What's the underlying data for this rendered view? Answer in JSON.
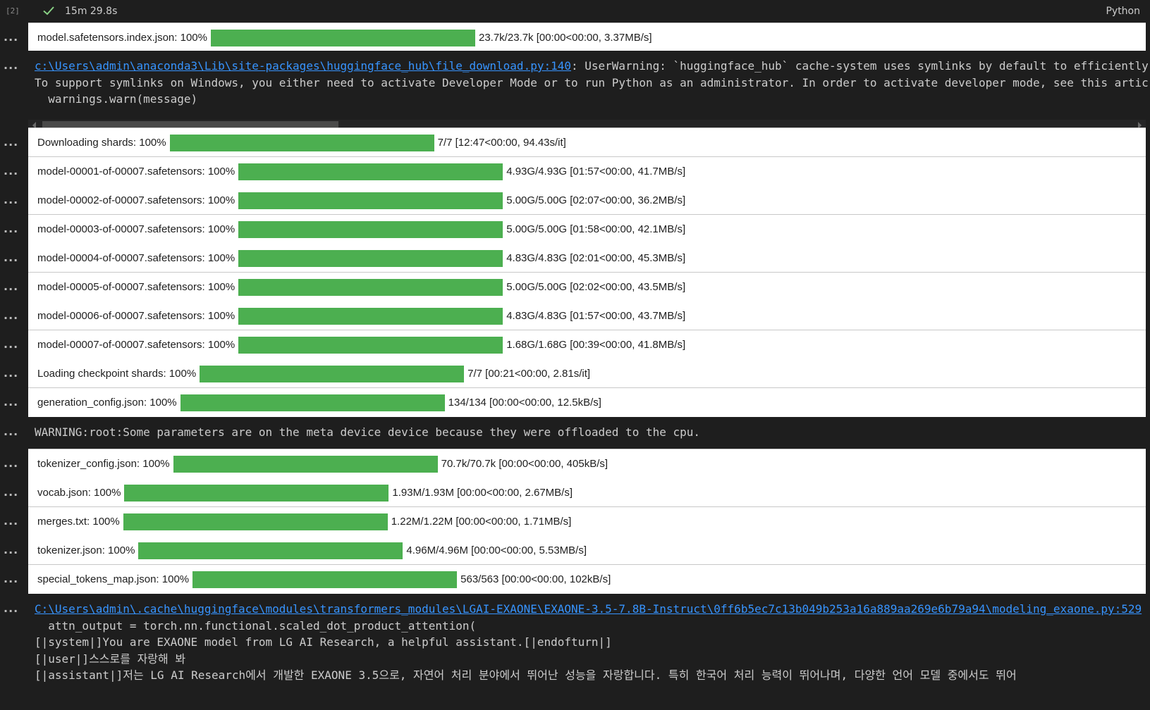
{
  "header": {
    "exec_count": "[2]",
    "duration": "15m 29.8s",
    "language": "Python",
    "status_icon": "check-icon"
  },
  "groups": [
    {
      "items": [
        {
          "label": "model.safetensors.index.json: 100%",
          "progress": 1.0,
          "stats": "23.7k/23.7k [00:00<00:00, 3.37MB/s]"
        }
      ]
    },
    {
      "items": [
        {
          "label": "Downloading shards: 100%",
          "progress": 1.0,
          "stats": "7/7 [12:47<00:00, 94.43s/it]"
        }
      ]
    },
    {
      "items": [
        {
          "label": "model-00001-of-00007.safetensors: 100%",
          "progress": 1.0,
          "stats": "4.93G/4.93G [01:57<00:00, 41.7MB/s]"
        },
        {
          "label": "model-00002-of-00007.safetensors: 100%",
          "progress": 1.0,
          "stats": "5.00G/5.00G [02:07<00:00, 36.2MB/s]"
        }
      ]
    },
    {
      "items": [
        {
          "label": "model-00003-of-00007.safetensors: 100%",
          "progress": 1.0,
          "stats": "5.00G/5.00G [01:58<00:00, 42.1MB/s]"
        },
        {
          "label": "model-00004-of-00007.safetensors: 100%",
          "progress": 1.0,
          "stats": "4.83G/4.83G [02:01<00:00, 45.3MB/s]"
        }
      ]
    },
    {
      "items": [
        {
          "label": "model-00005-of-00007.safetensors: 100%",
          "progress": 1.0,
          "stats": "5.00G/5.00G [02:02<00:00, 43.5MB/s]"
        },
        {
          "label": "model-00006-of-00007.safetensors: 100%",
          "progress": 1.0,
          "stats": "4.83G/4.83G [01:57<00:00, 43.7MB/s]"
        }
      ]
    },
    {
      "items": [
        {
          "label": "model-00007-of-00007.safetensors: 100%",
          "progress": 1.0,
          "stats": "1.68G/1.68G [00:39<00:00, 41.8MB/s]"
        },
        {
          "label": "Loading checkpoint shards: 100%",
          "progress": 1.0,
          "stats": "7/7 [00:21<00:00, 2.81s/it]"
        }
      ]
    },
    {
      "items": [
        {
          "label": "generation_config.json: 100%",
          "progress": 1.0,
          "stats": "134/134 [00:00<00:00, 12.5kB/s]"
        }
      ]
    },
    {
      "items": [
        {
          "label": "tokenizer_config.json: 100%",
          "progress": 1.0,
          "stats": "70.7k/70.7k [00:00<00:00, 405kB/s]"
        },
        {
          "label": "vocab.json: 100%",
          "progress": 1.0,
          "stats": "1.93M/1.93M [00:00<00:00, 2.67MB/s]"
        }
      ]
    },
    {
      "items": [
        {
          "label": "merges.txt: 100%",
          "progress": 1.0,
          "stats": "1.22M/1.22M [00:00<00:00, 1.71MB/s]"
        },
        {
          "label": "tokenizer.json: 100%",
          "progress": 1.0,
          "stats": "4.96M/4.96M [00:00<00:00, 5.53MB/s]"
        }
      ]
    },
    {
      "items": [
        {
          "label": "special_tokens_map.json: 100%",
          "progress": 1.0,
          "stats": "563/563 [00:00<00:00, 102kB/s]"
        }
      ]
    }
  ],
  "warning_block": {
    "link": "c:\\Users\\admin\\anaconda3\\Lib\\site-packages\\huggingface_hub\\file_download.py:140",
    "line1_rest": ": UserWarning: `huggingface_hub` cache-system uses symlinks by default to efficiently",
    "line2": "To support symlinks on Windows, you either need to activate Developer Mode or to run Python as an administrator. In order to activate developer mode, see this artic",
    "line3": "  warnings.warn(message)"
  },
  "root_warning": "WARNING:root:Some parameters are on the meta device device because they were offloaded to the cpu.",
  "final_block": {
    "link": "C:\\Users\\admin\\.cache\\huggingface\\modules\\transformers_modules\\LGAI-EXAONE\\EXAONE-3.5-7.8B-Instruct\\0ff6b5ec7c13b049b253a16a889aa269e6b79a94\\modeling_exaone.py:529",
    "line2": "  attn_output = torch.nn.functional.scaled_dot_product_attention(",
    "line3": "[|system|]You are EXAONE model from LG AI Research, a helpful assistant.[|endofturn|]",
    "line4": "[|user|]스스로를 자랑해 봐",
    "line5": "[|assistant|]저는 LG AI Research에서 개발한 EXAONE 3.5으로, 자연어 처리 분야에서 뛰어난 성능을 자랑합니다. 특히 한국어 처리 능력이 뛰어나며, 다양한 언어 모델 중에서도 뛰어"
  },
  "ellipsis": "..."
}
